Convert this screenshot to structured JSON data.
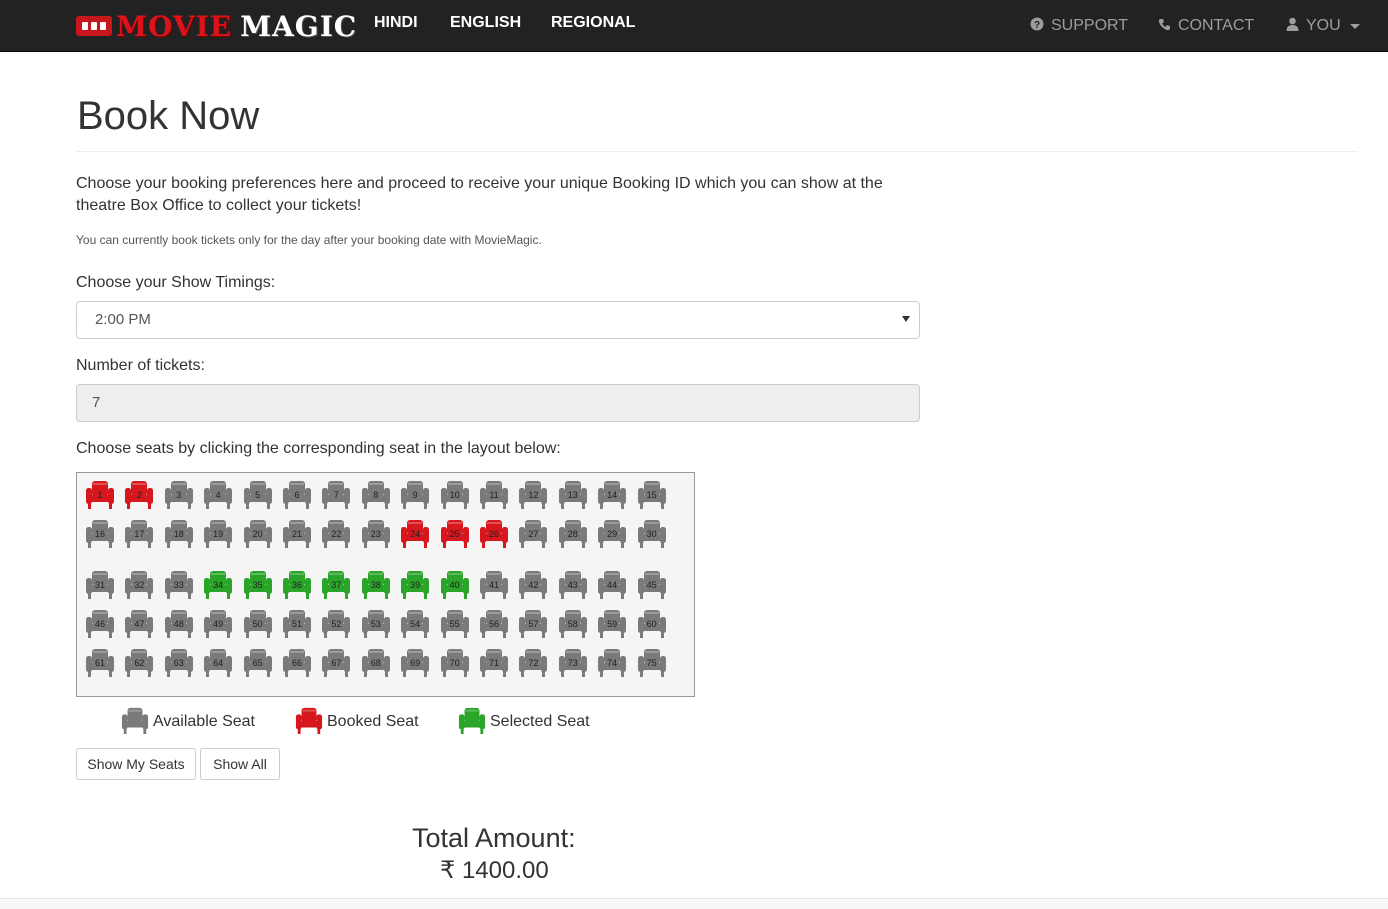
{
  "brand": {
    "word_a": "MOVIE",
    "word_b": "MAGIC"
  },
  "nav": {
    "left": [
      {
        "label": "HINDI"
      },
      {
        "label": "ENGLISH"
      },
      {
        "label": "REGIONAL"
      }
    ],
    "support": {
      "label": "SUPPORT",
      "icon": "question-circle-icon"
    },
    "contact": {
      "label": "CONTACT",
      "icon": "phone-icon"
    },
    "user": {
      "label": "YOU",
      "icon": "user-icon"
    }
  },
  "page": {
    "title": "Book Now",
    "intro": "Choose your booking preferences here and proceed to receive your unique Booking ID which you can show at the theatre Box Office to collect your tickets!",
    "note": "You can currently book tickets only for the day after your booking date with MovieMagic.",
    "timings_label": "Choose your Show Timings:",
    "timings_value": "2:00 PM",
    "tickets_label": "Number of tickets:",
    "tickets_value": "7",
    "seats_label": "Choose seats by clicking the corresponding seat in the layout below:"
  },
  "seats": {
    "booked": [
      1,
      2,
      24,
      25,
      26
    ],
    "selected": [
      34,
      35,
      36,
      37,
      38,
      39,
      40
    ],
    "total": 75,
    "per_row": 15
  },
  "legend": {
    "available": "Available Seat",
    "booked": "Booked Seat",
    "selected": "Selected Seat"
  },
  "colors": {
    "available": "#7a7a7a",
    "booked": "#d6171d",
    "selected": "#2aa52a",
    "navbar": "#222222"
  },
  "buttons": {
    "show_my_seats": "Show My Seats",
    "show_all": "Show All"
  },
  "total": {
    "label": "Total Amount:",
    "value": "₹ 1400.00"
  }
}
